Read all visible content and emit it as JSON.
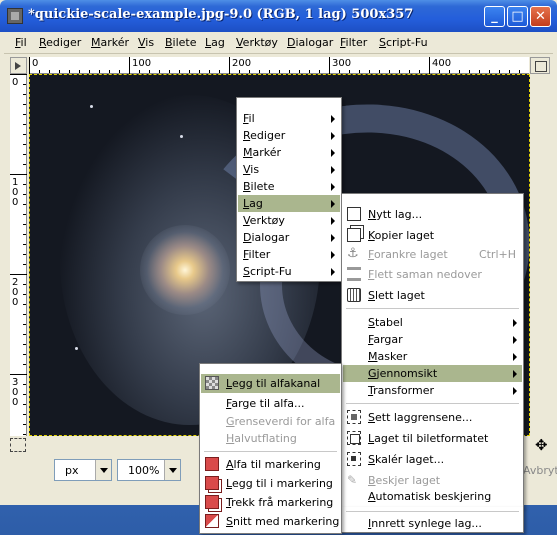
{
  "window": {
    "title": "*quickie-scale-example.jpg-9.0 (RGB, 1 lag) 500x357",
    "minimize_label": "_",
    "maximize_label": "□",
    "close_label": "✕"
  },
  "menubar": {
    "items": [
      "Fil",
      "Rediger",
      "Markér",
      "Vis",
      "Bilete",
      "Lag",
      "Verktøy",
      "Dialogar",
      "Filter",
      "Script-Fu"
    ]
  },
  "rulers": {
    "horizontal_labels": [
      "0",
      "100",
      "200",
      "300",
      "400"
    ],
    "vertical_labels": [
      "0",
      "1 0 0",
      "2 0 0",
      "3 0 0"
    ]
  },
  "statusbar": {
    "unit": "px",
    "zoom": "100%",
    "cancel": "Avbryt"
  },
  "context_menu": {
    "items": [
      "Fil",
      "Rediger",
      "Markér",
      "Vis",
      "Bilete",
      "Lag",
      "Verktøy",
      "Dialogar",
      "Filter",
      "Script-Fu"
    ],
    "highlighted": "Lag"
  },
  "lag_submenu": {
    "items": [
      {
        "label": "Nytt lag...",
        "shortcut": "",
        "disabled": false,
        "icon": "new-layer-icon"
      },
      {
        "label": "Kopier laget",
        "shortcut": "",
        "disabled": false,
        "icon": "duplicate-layer-icon"
      },
      {
        "label": "Forankre laget",
        "shortcut": "Ctrl+H",
        "disabled": true,
        "icon": "anchor-icon"
      },
      {
        "label": "Flett saman nedover",
        "shortcut": "",
        "disabled": true,
        "icon": "merge-down-icon"
      },
      {
        "label": "Slett laget",
        "shortcut": "",
        "disabled": false,
        "icon": "trash-icon"
      },
      {
        "label": "Stabel",
        "submenu": true
      },
      {
        "label": "Fargar",
        "submenu": true
      },
      {
        "label": "Masker",
        "submenu": true
      },
      {
        "label": "Gjennomsikt",
        "submenu": true,
        "highlighted": true
      },
      {
        "label": "Transformer",
        "submenu": true
      },
      {
        "label": "Sett laggrensene...",
        "icon": "layer-boundary-icon"
      },
      {
        "label": "Laget til biletformatet",
        "icon": "layer-to-image-size-icon"
      },
      {
        "label": "Skalér laget...",
        "icon": "scale-layer-icon"
      },
      {
        "label": "Beskjer laget",
        "disabled": true,
        "icon": "crop-layer-icon"
      },
      {
        "label": "Automatisk beskjering"
      },
      {
        "label": "Innrett synlege lag..."
      }
    ]
  },
  "transparency_submenu": {
    "items": [
      {
        "label": "Legg til alfakanal",
        "highlighted": true,
        "icon": "alpha-channel-icon"
      },
      {
        "label": "Farge til alfa..."
      },
      {
        "label": "Grenseverdi for alfa",
        "disabled": true
      },
      {
        "label": "Halvutflating",
        "disabled": true
      },
      {
        "label": "Alfa til markering",
        "icon": "alpha-to-selection-icon"
      },
      {
        "label": "Legg til i markering",
        "icon": "add-to-selection-icon"
      },
      {
        "label": "Trekk frå markering",
        "icon": "subtract-from-selection-icon"
      },
      {
        "label": "Snitt med markering",
        "icon": "intersect-selection-icon"
      }
    ]
  }
}
